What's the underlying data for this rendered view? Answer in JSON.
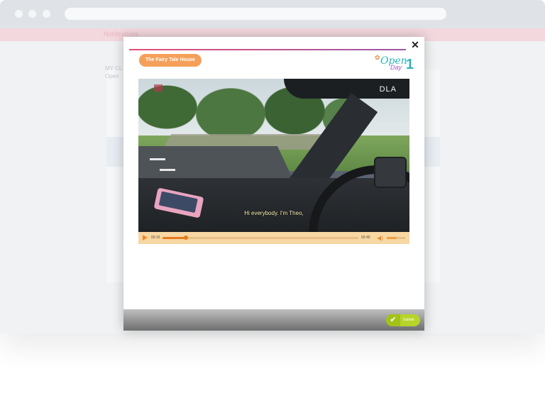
{
  "browser": {
    "app_title": "Notifications"
  },
  "background": {
    "line1": "MY CL",
    "line2": "Open"
  },
  "modal": {
    "close_label": "✕",
    "activity_tag": "The Fairy Tale House",
    "logo": {
      "word": "Open",
      "sub": "Day",
      "number": "1"
    },
    "video": {
      "brand": "DLA",
      "subtitle": "Hi everybody. I'm Theo,",
      "current_time": "00:15",
      "duration": "02:45",
      "progress": 0.12,
      "volume": 0.55
    },
    "footer": {
      "submit_label": "Submit"
    }
  },
  "colors": {
    "tag": "#f5a05a",
    "accent_line_start": "#e44f77",
    "accent_line_end": "#9d58a6",
    "submit": "#b6d429",
    "player_bar": "#f7d7a3"
  },
  "icons": [
    "close-icon",
    "play-icon",
    "volume-icon",
    "check-icon"
  ]
}
